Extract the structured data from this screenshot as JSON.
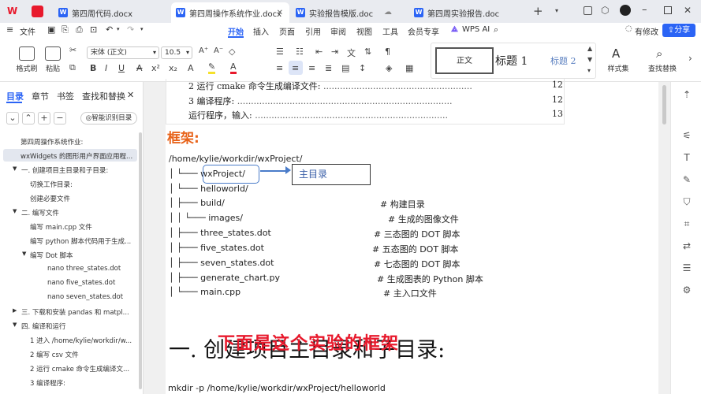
{
  "tabs": [
    {
      "label": "第四周代码.docx"
    },
    {
      "label": "第四周操作系统作业.docx"
    },
    {
      "label": "实验报告模版.doc"
    },
    {
      "label": "第四周实验报告.doc"
    }
  ],
  "menu": {
    "file": "文件",
    "items": [
      "开始",
      "插入",
      "页面",
      "引用",
      "审阅",
      "视图",
      "工具",
      "会员专享"
    ],
    "wps_ai": "WPS AI",
    "changes": "有修改",
    "share": "分享"
  },
  "ribbon": {
    "format_painter": "格式刷",
    "paste": "粘贴",
    "font_name": "宋体 (正文)",
    "font_size": "10.5",
    "styles": {
      "normal": "正文",
      "h1": "标题  1",
      "h2": "标题  2"
    },
    "style_set": "样式集",
    "find_replace": "查找替换"
  },
  "sidebar": {
    "tabs": [
      "目录",
      "章节",
      "书签",
      "查找和替换"
    ],
    "smart_toc": "智能识别目录",
    "toc": [
      "第四周操作系统作业:",
      "wxWidgets 的图形用户界面应用程...",
      "一. 创建项目主目录和子目录:",
      "切换工作目录:",
      "创建必要文件",
      "二. 编写文件",
      "编写 main.cpp 文件",
      "编写 python 脚本代码用于生成...",
      "编写 Dot 脚本",
      "nano three_states.dot",
      "nano five_states.dot",
      "nano seven_states.dot",
      "三. 下载和安装 pandas 和 matpl...",
      "四. 编译和运行",
      "1 进入 /home/kylie/workdir/w...",
      "2 编写 csv 文件",
      "2 运行 cmake 命令生成编译文...",
      "3 编译程序:"
    ]
  },
  "doc": {
    "toc_lines": [
      {
        "text": "2 运行  cmake  命令生成编译文件:",
        "page": "12"
      },
      {
        "text": "3 编译程序:",
        "page": "12"
      },
      {
        "text": "运行程序，输入:",
        "page": "13"
      }
    ],
    "frame_title": "框架:",
    "tree": [
      {
        "t": "/home/kylie/workdir/wxProject/",
        "c": ""
      },
      {
        "t": "│  └───  wxProject/",
        "c": ""
      },
      {
        "t": "│        └───  helloworld/",
        "c": ""
      },
      {
        "t": "│              ├───  build/",
        "c": "#  构建目录"
      },
      {
        "t": "│              │     └───  images/",
        "c": "#  生成的图像文件"
      },
      {
        "t": "│              ├───  three_states.dot",
        "c": "#  三态图的  DOT  脚本"
      },
      {
        "t": "│              ├───  five_states.dot",
        "c": "#  五态图的  DOT  脚本"
      },
      {
        "t": "│              ├───  seven_states.dot",
        "c": "#  七态图的  DOT  脚本"
      },
      {
        "t": "│              ├───  generate_chart.py",
        "c": "#  生成图表的  Python  脚本"
      },
      {
        "t": "│              └───  main.cpp",
        "c": "#  主入口文件"
      }
    ],
    "annotation": "主目录",
    "overlay_text": "下面是这个实验的框架",
    "heading": "一. 创建项目主目录和子目录:",
    "bottom_code": "mkdir -p /home/kylie/workdir/wxProject/helloworld"
  },
  "colors": {
    "accent": "#2b64f5",
    "overlay": "#e8192c",
    "frame_title": "#e8631a"
  }
}
